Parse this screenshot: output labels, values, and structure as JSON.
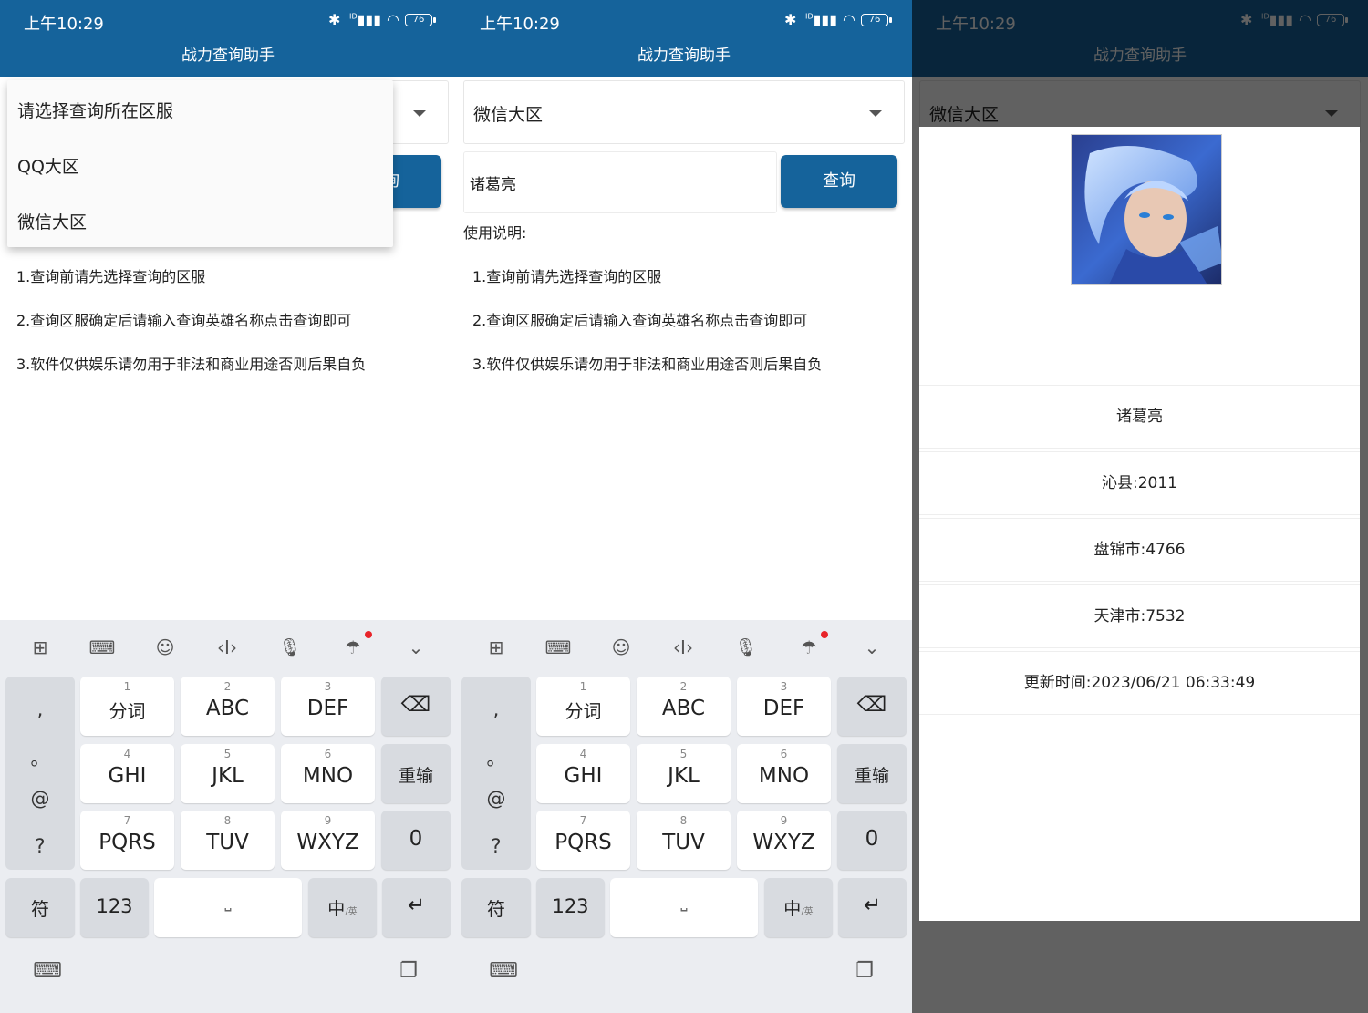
{
  "status": {
    "time": "上午10:29",
    "battery": "76"
  },
  "app": {
    "title": "战力查询助手"
  },
  "query_label": "查询",
  "instructions": {
    "title": "使用说明:",
    "items": [
      "1.查询前请先选择查询的区服",
      "2.查询区服确定后请输入查询英雄名称点击查询即可",
      "3.软件仅供娱乐请勿用于非法和商业用途否则后果自负"
    ]
  },
  "dropdown": {
    "options": [
      "请选择查询所在区服",
      "QQ大区",
      "微信大区"
    ]
  },
  "spinner": {
    "selected": "微信大区"
  },
  "hero_input": {
    "value": "诸葛亮"
  },
  "keyboard": {
    "side": [
      ",",
      "。",
      "@",
      "?"
    ],
    "keys": [
      {
        "num": "1",
        "label": "分词"
      },
      {
        "num": "2",
        "label": "ABC"
      },
      {
        "num": "3",
        "label": "DEF"
      },
      {
        "num": "4",
        "label": "GHI"
      },
      {
        "num": "5",
        "label": "JKL"
      },
      {
        "num": "6",
        "label": "MNO"
      },
      {
        "num": "7",
        "label": "PQRS"
      },
      {
        "num": "8",
        "label": "TUV"
      },
      {
        "num": "9",
        "label": "WXYZ"
      }
    ],
    "retype": "重输",
    "zero": "0",
    "symbol": "符",
    "num123": "123",
    "lang_main": "中",
    "lang_sub": "/英"
  },
  "result": {
    "hero": "诸葛亮",
    "county": "沁县:2011",
    "city": "盘锦市:4766",
    "province": "天津市:7532",
    "updated": "更新时间:2023/06/21 06:33:49"
  },
  "colors": {
    "brand": "#15639b",
    "keyboard_bg": "#ebedf1",
    "notification_dot": "#e8242a"
  }
}
